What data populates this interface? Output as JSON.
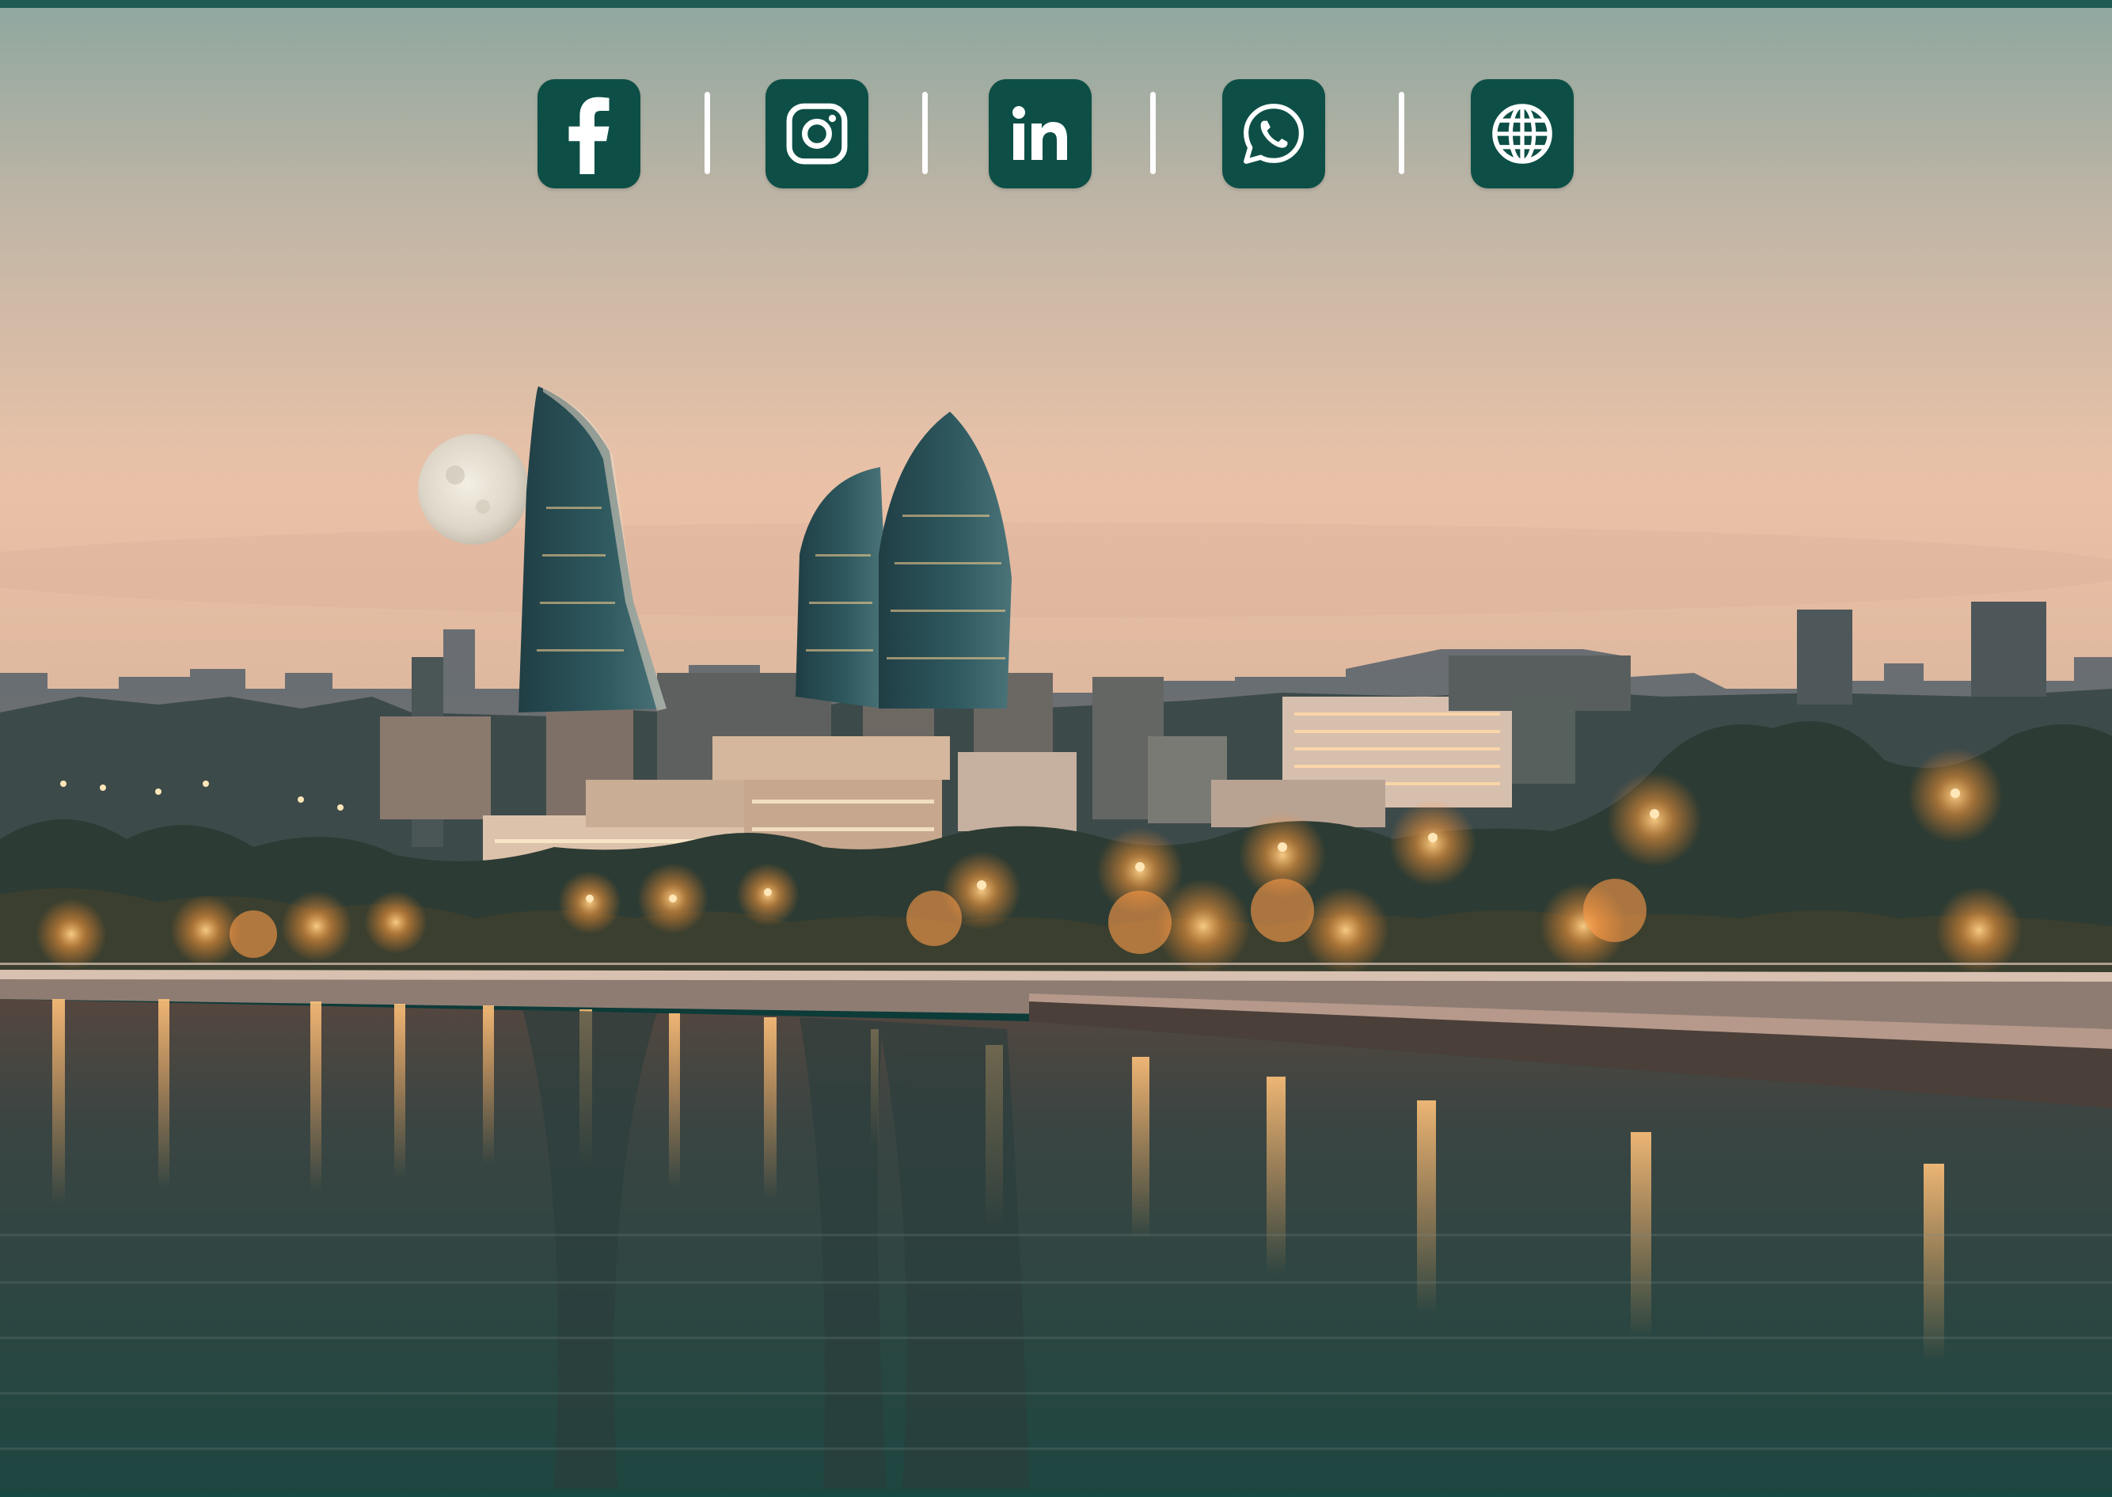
{
  "page": {
    "colors": {
      "accent": "#0d4f46",
      "top_bar": "#1f5b52",
      "icon_glyph": "#ffffff",
      "sky_top": "#8fa8a0",
      "sky_horizon": "#f0c0a4",
      "water": "#2a4a46",
      "city_lights": "#ffb15a"
    }
  },
  "social_links": [
    {
      "id": "facebook",
      "icon": "facebook-icon"
    },
    {
      "id": "instagram",
      "icon": "instagram-icon"
    },
    {
      "id": "linkedin",
      "icon": "linkedin-icon"
    },
    {
      "id": "whatsapp",
      "icon": "whatsapp-icon"
    },
    {
      "id": "website",
      "icon": "globe-icon"
    }
  ],
  "background": {
    "icon": "city-skyline-photo"
  }
}
